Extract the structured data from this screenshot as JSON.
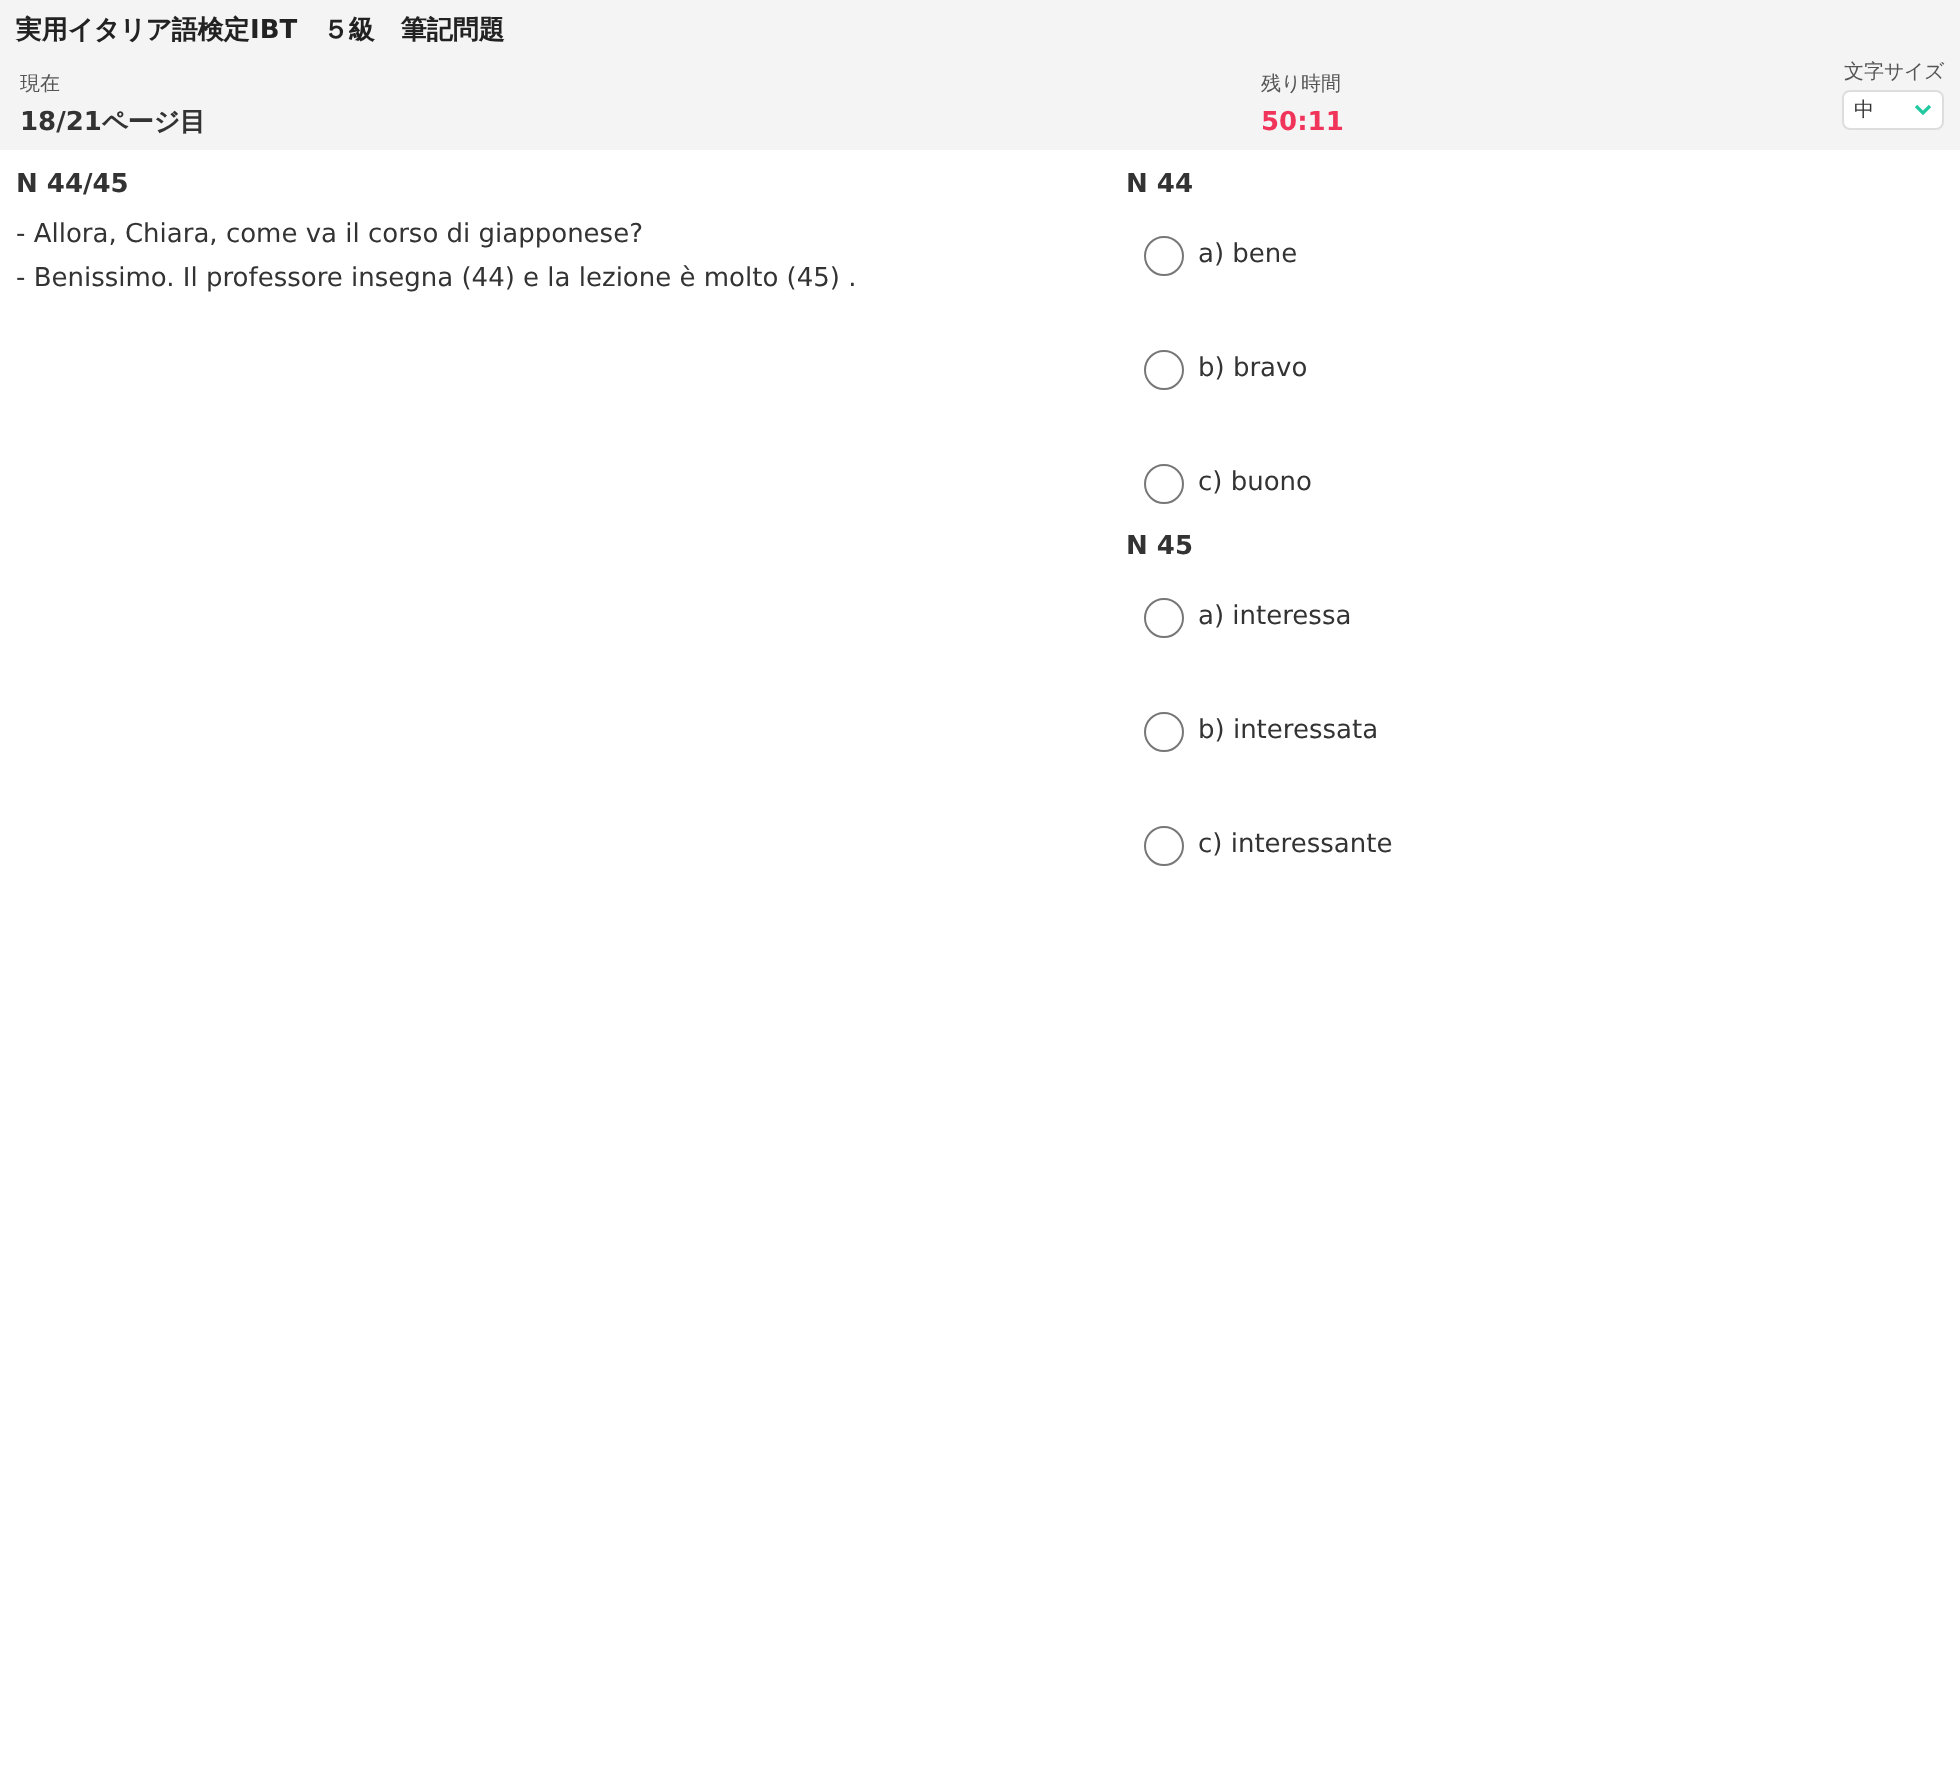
{
  "header": {
    "title": "実用イタリア語検定IBT　５級　筆記問題",
    "current_label": "現在",
    "current_value": "18/21ページ目",
    "remaining_label": "残り時間",
    "remaining_value": "50:11",
    "font_size_label": "文字サイズ",
    "font_size_value": "中"
  },
  "passage": {
    "heading": "N 44/45",
    "lines": [
      "- Allora, Chiara, come va il corso di giapponese?",
      "- Benissimo. Il professore insegna (44) e la lezione è molto (45) ."
    ]
  },
  "questions": [
    {
      "heading": "N 44",
      "options": [
        {
          "label": "a) bene",
          "selected": false
        },
        {
          "label": "b) bravo",
          "selected": false
        },
        {
          "label": "c) buono",
          "selected": false
        }
      ]
    },
    {
      "heading": "N 45",
      "options": [
        {
          "label": "a) interessa",
          "selected": false
        },
        {
          "label": "b) interessata",
          "selected": false
        },
        {
          "label": "c) interessante",
          "selected": false
        }
      ]
    }
  ]
}
